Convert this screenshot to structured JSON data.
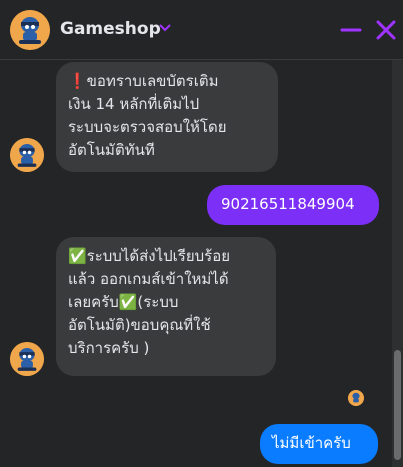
{
  "header": {
    "title": "Gameshop",
    "avatar_icon": "gameshop-logo-icon",
    "minimize_icon": "minimize-icon",
    "close_icon": "close-icon",
    "accent_color": "#a033ff"
  },
  "messages": [
    {
      "from": "shop",
      "text": "❗ขอทราบเลขบัตรเติม\nเงิน 14 หลักที่เติมไป\nระบบจะตรวจสอบให้โดย\nอัตโนมัติทันที"
    },
    {
      "from": "user",
      "text": "90216511849904"
    },
    {
      "from": "shop",
      "text": "✅ระบบได้ส่งไปเรียบร้อย\nแล้ว ออกเกมส์เข้าใหม่ได้\nเลยครับ✅(ระบบ\nอัตโนมัติ)ขอบคุณที่ใช้\nบริการครับ )"
    },
    {
      "from": "user",
      "text": "ไม่มีเข้าครับ"
    }
  ],
  "colors": {
    "background": "#242526",
    "incoming_bubble": "#3a3b3c",
    "outgoing_bubble_purple": "#7b2ff7",
    "outgoing_bubble_blue": "#0a7cff"
  }
}
